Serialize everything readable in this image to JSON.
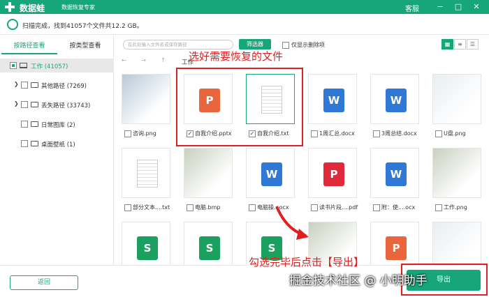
{
  "app": {
    "name": "数据蛙",
    "subtitle": "数据恢复专家",
    "service": "客服",
    "minimize": "−",
    "maximize": "□",
    "close": "✕"
  },
  "status": {
    "text": "扫描完成，找到41057个文件共12.2 GB。"
  },
  "sidebar": {
    "tabs": [
      "按路径查看",
      "按类型查看"
    ],
    "tree": [
      {
        "label": "工作 (41057)"
      },
      {
        "label": "其他路径 (7269)"
      },
      {
        "label": "丢失路径 (33743)"
      },
      {
        "label": "日常图库 (2)"
      },
      {
        "label": "桌面壁纸 (1)"
      }
    ]
  },
  "toolbar": {
    "search_placeholder": "在此处输入文件名或保存路径",
    "filter_label": "筛选器",
    "deleted_only_label": "仅显示删除项"
  },
  "nav": {
    "back": "←",
    "forward": "→",
    "up": "↑",
    "path": "工作"
  },
  "files": [
    {
      "name": "咨询.png",
      "icon": "image-icon",
      "checked": false
    },
    {
      "name": "自我介绍.pptx",
      "icon": "ppt-icon",
      "checked": true
    },
    {
      "name": "自我介绍.txt",
      "icon": "txt-icon",
      "checked": true
    },
    {
      "name": "1周汇总.docx",
      "icon": "word-icon",
      "checked": false
    },
    {
      "name": "3周总结.docx",
      "icon": "word-icon",
      "checked": false
    },
    {
      "name": "U盘.png",
      "icon": "image-icon",
      "checked": false
    },
    {
      "name": "部分文本....txt",
      "icon": "txt-icon",
      "checked": false
    },
    {
      "name": "电脑.bmp",
      "icon": "image-icon",
      "checked": false
    },
    {
      "name": "电脑操...ocx",
      "icon": "word-icon",
      "checked": false
    },
    {
      "name": "读书片段....pdf",
      "icon": "pdf-icon",
      "checked": false
    },
    {
      "name": "附：使....ocx",
      "icon": "word-icon",
      "checked": false
    },
    {
      "name": "工作.png",
      "icon": "image-icon",
      "checked": false
    },
    {
      "name": "",
      "icon": "excel-icon",
      "checked": false
    },
    {
      "name": "",
      "icon": "excel-icon",
      "checked": false
    },
    {
      "name": "",
      "icon": "excel-icon",
      "checked": false
    },
    {
      "name": "",
      "icon": "image-icon",
      "checked": false
    },
    {
      "name": "",
      "icon": "ppt-icon",
      "checked": false
    },
    {
      "name": "",
      "icon": "image-icon",
      "checked": false
    }
  ],
  "bottom": {
    "back_label": "返回",
    "export_label": "导出"
  },
  "annotations": {
    "top": "选好需要恢复的文件",
    "bottom": "勾选完毕后点击【导出】",
    "watermark": "掘金技术社区 @ 小明助手"
  },
  "colors": {
    "accent": "#17a679",
    "annotation": "#e02020"
  }
}
